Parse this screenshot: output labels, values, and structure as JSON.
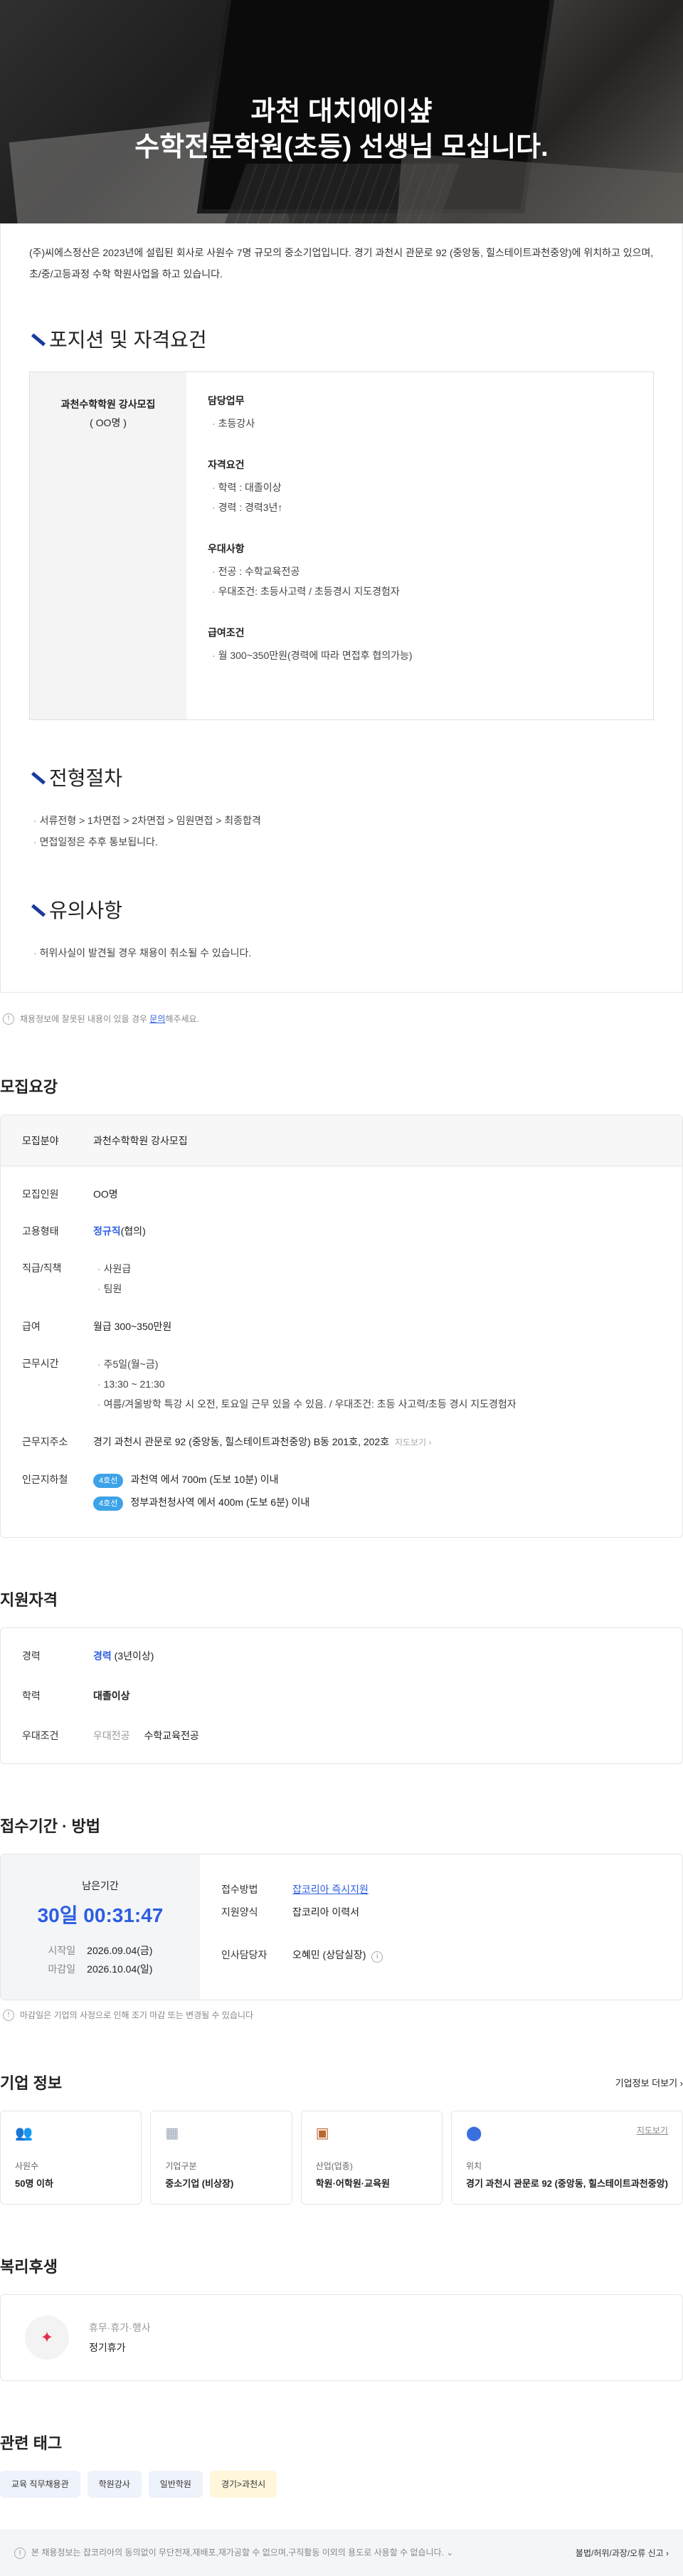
{
  "hero": {
    "line1": "과천 대치에이샾",
    "line2": "수학전문학원(초등) 선생님 모십니다."
  },
  "intro": "(주)씨에스정산은 2023년에 설립된 회사로 사원수 7명 규모의 중소기업입니다. 경기 과천시 관문로 92 (중앙동, 힐스테이트과천중앙)에 위치하고 있으며, 초/중/고등과정 수학 학원사업을 하고 있습니다.",
  "position_section": {
    "title": "포지션 및 자격요건",
    "job_title": "과천수학학원 강사모집",
    "job_count": "( OO명 )",
    "groups": [
      {
        "title": "담당업무",
        "items": [
          "초등강사"
        ]
      },
      {
        "title": "자격요건",
        "items": [
          "학력 : 대졸이상",
          "경력 : 경력3년↑"
        ]
      },
      {
        "title": "우대사항",
        "items": [
          "전공 : 수학교육전공",
          "우대조건: 초등사고력 / 초등경시 지도경험자"
        ]
      },
      {
        "title": "급여조건",
        "items": [
          "월 300~350만원(경력에 따라 면접후 협의가능)"
        ]
      }
    ]
  },
  "process_section": {
    "title": "전형절차",
    "items": [
      "서류전형 > 1차면접 > 2차면접 > 임원면접 > 최종합격",
      "면접일정은 추후 통보됩니다."
    ]
  },
  "caution_section": {
    "title": "유의사항",
    "items": [
      "허위사실이 발견될 경우 채용이 취소될 수 있습니다."
    ]
  },
  "report_notice": {
    "text": "채용정보에 잘못된 내용이 있을 경우 ",
    "link": "문의",
    "tail": "해주세요."
  },
  "requirements": {
    "title": "모집요강",
    "field_label": "모집분야",
    "field_value": "과천수학학원 강사모집",
    "headcount_label": "모집인원",
    "headcount_value": "OO명",
    "employment_label": "고용형태",
    "employment_value": "정규직",
    "employment_note": "(협의)",
    "rank_label": "직급/직책",
    "rank_items": [
      "사원급",
      "팀원"
    ],
    "salary_label": "급여",
    "salary_value": "월급 300~350만원",
    "hours_label": "근무시간",
    "hours_items": [
      "주5일(월~금)",
      "13:30 ~ 21:30",
      "여름/겨울방학 특강 시 오전, 토요일 근무 있을 수 있음. / 우대조건: 초등 사고력/초등 경시 지도경험자"
    ],
    "address_label": "근무지주소",
    "address_value": "경기 과천시 관문로 92 (중앙동, 힐스테이트과천중앙) B동 201호, 202호",
    "map_link": "지도보기",
    "nearby_label": "인근지하철",
    "nearby": [
      {
        "line": "4호선",
        "text": "과천역 에서 700m (도보 10분) 이내"
      },
      {
        "line": "4호선",
        "text": "정부과천청사역 에서 400m (도보 6분) 이내"
      }
    ]
  },
  "qualifications": {
    "title": "지원자격",
    "career_label": "경력",
    "career_value": "경력",
    "career_note": "(3년이상)",
    "edu_label": "학력",
    "edu_value": "대졸이상",
    "pref_label": "우대조건",
    "pref_key": "우대전공",
    "pref_value": "수학교육전공"
  },
  "apply": {
    "title": "접수기간 · 방법",
    "remaining_label": "남은기간",
    "countdown": "30일 00:31:47",
    "start_label": "시작일",
    "start_value": "2026.09.04(금)",
    "end_label": "마감일",
    "end_value": "2026.10.04(일)",
    "method_label": "접수방법",
    "method_value": "잡코리아 즉시지원",
    "form_label": "지원양식",
    "form_value": "잡코리아 이력서",
    "hr_label": "인사담당자",
    "hr_value": "오혜민 (상담실장)",
    "deadline_notice": "마감일은 기업의 사정으로 인해 조기 마감 또는 변경될 수 있습니다"
  },
  "company": {
    "title": "기업 정보",
    "more_link": "기업정보 더보기",
    "cards": [
      {
        "icon": "people-icon",
        "label": "사원수",
        "value": "50명 이하"
      },
      {
        "icon": "building-icon",
        "label": "기업구분",
        "value": "중소기업 (비상장)"
      },
      {
        "icon": "briefcase-icon",
        "label": "산업(업종)",
        "value": "학원·어학원·교육원"
      },
      {
        "icon": "map-pin-icon",
        "label": "위치",
        "value": "경기 과천시 관문로 92 (중앙동, 힐스테이트과천중앙)",
        "link": "지도보기"
      }
    ]
  },
  "welfare": {
    "title": "복리후생",
    "category": "휴무·휴가·행사",
    "item": "정기휴가"
  },
  "tags": {
    "title": "관련 태그",
    "items": [
      "교육 직무채용관",
      "학원강사",
      "일반학원",
      "경기>과천시"
    ]
  },
  "footer": {
    "notice": "본 채용정보는 잡코리아의 동의없이 무단전재,재배포,재가공할 수 없으며,구직활동 이외의 용도로 사용할 수 없습니다.",
    "report": "불법/허위/과장/오류 신고"
  },
  "colors": {
    "accent": "#2c5ee0",
    "subway_badge": "#3da3e8",
    "heading_mark": "#1a3a9e"
  }
}
